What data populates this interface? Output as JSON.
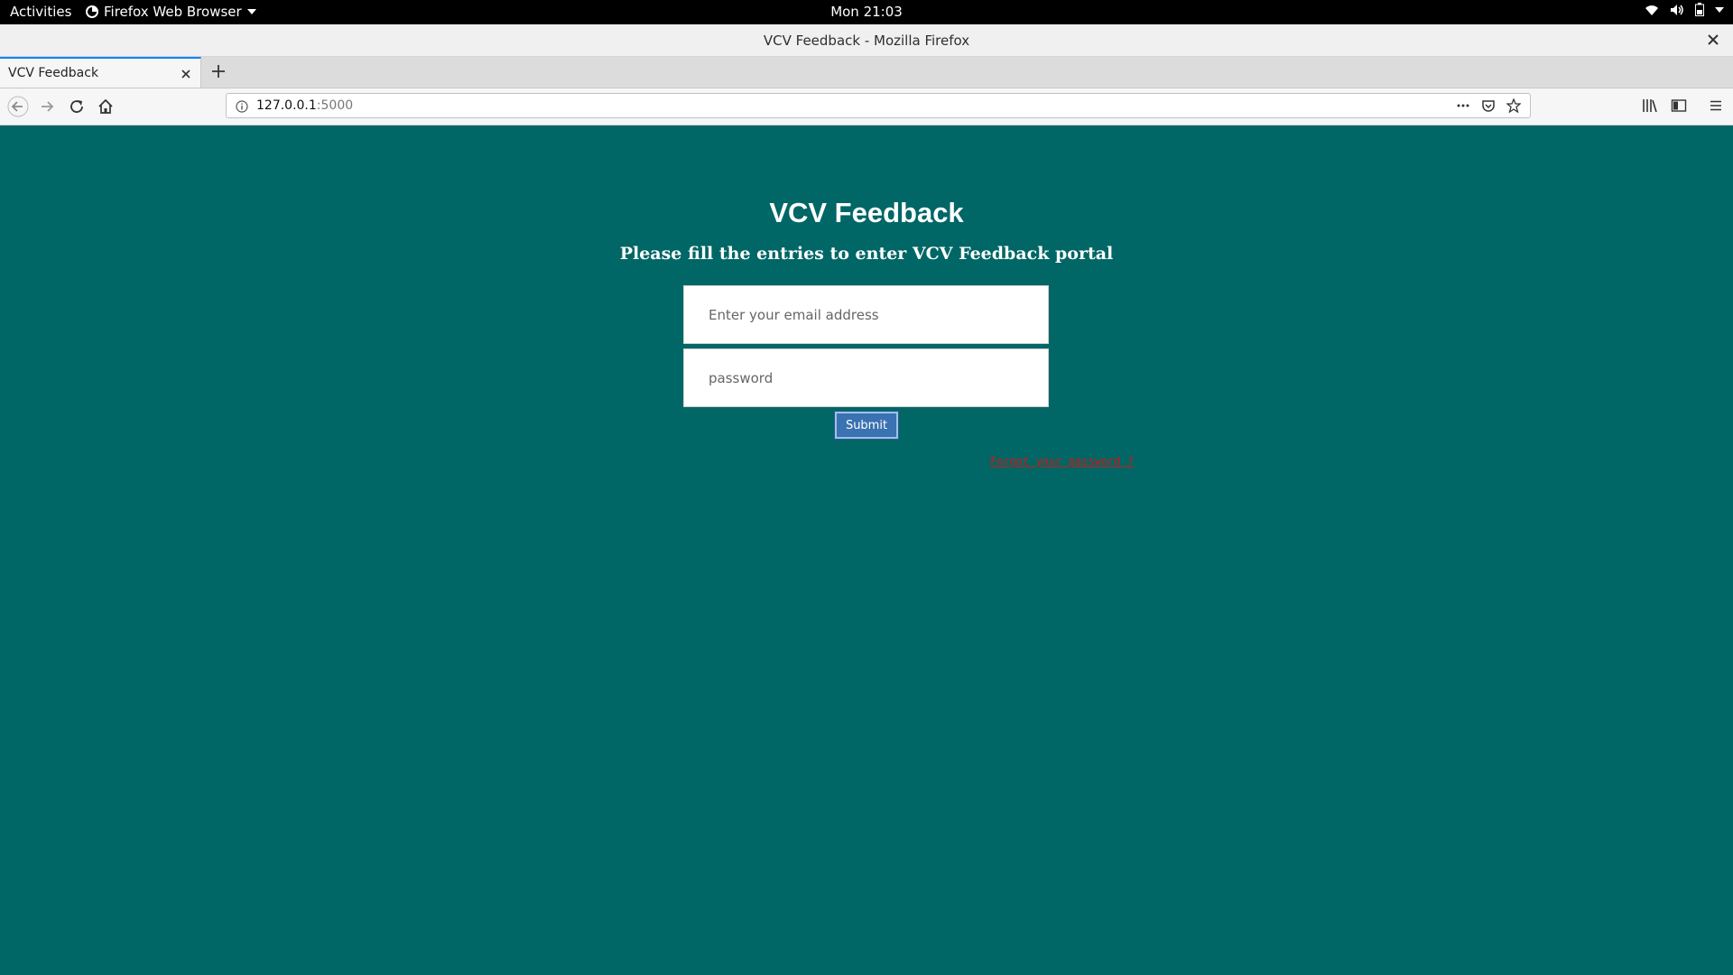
{
  "topbar": {
    "activities": "Activities",
    "app_menu": "Firefox Web Browser",
    "clock": "Mon 21:03"
  },
  "window": {
    "title": "VCV Feedback - Mozilla Firefox"
  },
  "tabs": [
    {
      "label": "VCV Feedback",
      "active": true
    }
  ],
  "navbar": {
    "url_host": "127.0.0.1",
    "url_port": ":5000"
  },
  "page": {
    "heading": "VCV Feedback",
    "subheading": "Please fill the entries to enter VCV Feedback portal",
    "email_placeholder": "Enter your email address",
    "email_value": "",
    "password_placeholder": "password",
    "password_value": "",
    "submit_label": "Submit",
    "forgot_link": "Forgot your password ?"
  },
  "colors": {
    "page_background": "#006666",
    "submit_background": "#3a72b2",
    "forgot_link": "#e01010"
  },
  "icons": [
    "firefox-icon",
    "wifi-icon",
    "volume-icon",
    "battery-icon",
    "close-icon",
    "plus-icon",
    "back-icon",
    "forward-icon",
    "reload-icon",
    "home-icon",
    "info-icon",
    "more-icon",
    "pocket-icon",
    "bookmark-star-icon",
    "library-icon",
    "sidebar-icon",
    "menu-icon"
  ]
}
